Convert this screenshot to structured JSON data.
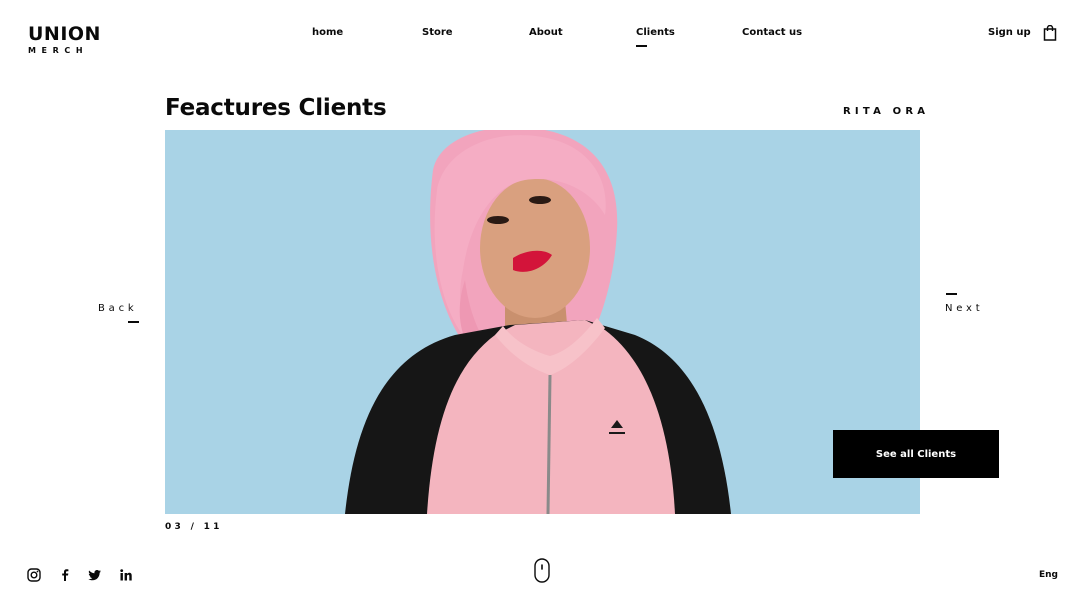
{
  "brand": {
    "name": "UNION",
    "tagline": "MERCH"
  },
  "nav": {
    "items": [
      {
        "label": "home"
      },
      {
        "label": "Store"
      },
      {
        "label": "About"
      },
      {
        "label": "Clients",
        "active": true
      },
      {
        "label": "Contact us"
      }
    ],
    "signup_label": "Sign up",
    "cart_icon": "shopping-bag-icon"
  },
  "main": {
    "title": "Feactures Clients",
    "client_name": "RITA ORA",
    "back_label": "Back",
    "next_label": "Next",
    "cta_label": "See all Clients",
    "counter": {
      "current": "03",
      "separator": "/",
      "total": "11"
    }
  },
  "footer": {
    "social": [
      "instagram-icon",
      "facebook-icon",
      "twitter-icon",
      "linkedin-icon"
    ],
    "scroll_icon": "mouse-scroll-icon",
    "language": "Eng"
  },
  "colors": {
    "text": "#0a0a0a",
    "background": "#ffffff",
    "hero_background": "#a9d3e6",
    "button_bg": "#000000",
    "button_text": "#ffffff"
  }
}
